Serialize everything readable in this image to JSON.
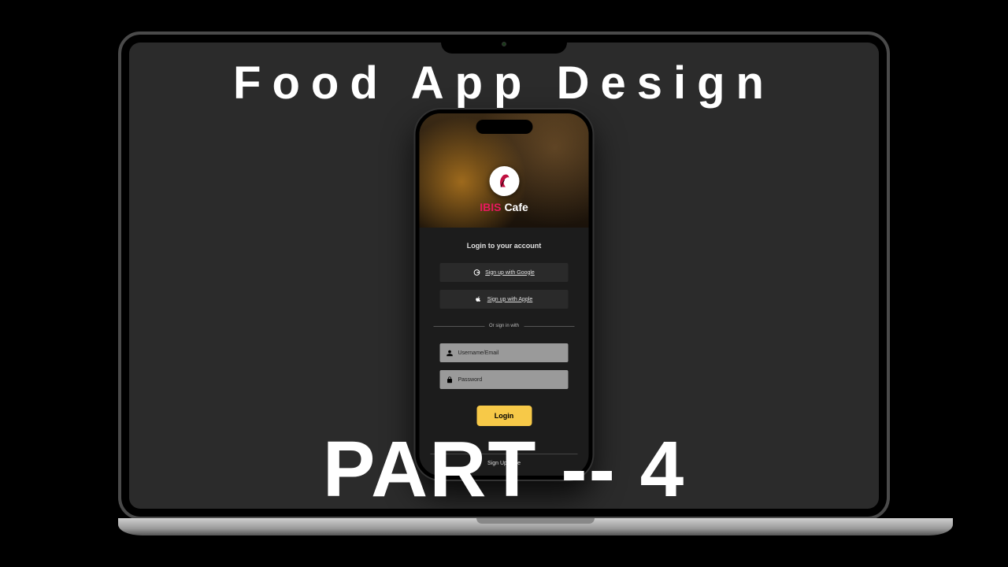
{
  "overlay": {
    "title_top": "Food App Design",
    "title_bottom": "PART -- 4"
  },
  "brand": {
    "logo_icon": "ibis-logo",
    "name_accent": "IBIS",
    "name_rest": "Cafe"
  },
  "login": {
    "heading": "Login to your account",
    "google_label": "Sign up with Google",
    "apple_label": "Sign up with Apple",
    "divider": "Or sign in with",
    "username_placeholder": "Username/Email",
    "password_placeholder": "Password",
    "submit_label": "Login",
    "signup_footer": "Sign Up Here"
  },
  "colors": {
    "accent": "#e6195d",
    "button": "#f7c948",
    "screen_bg": "#2b2b2b"
  }
}
